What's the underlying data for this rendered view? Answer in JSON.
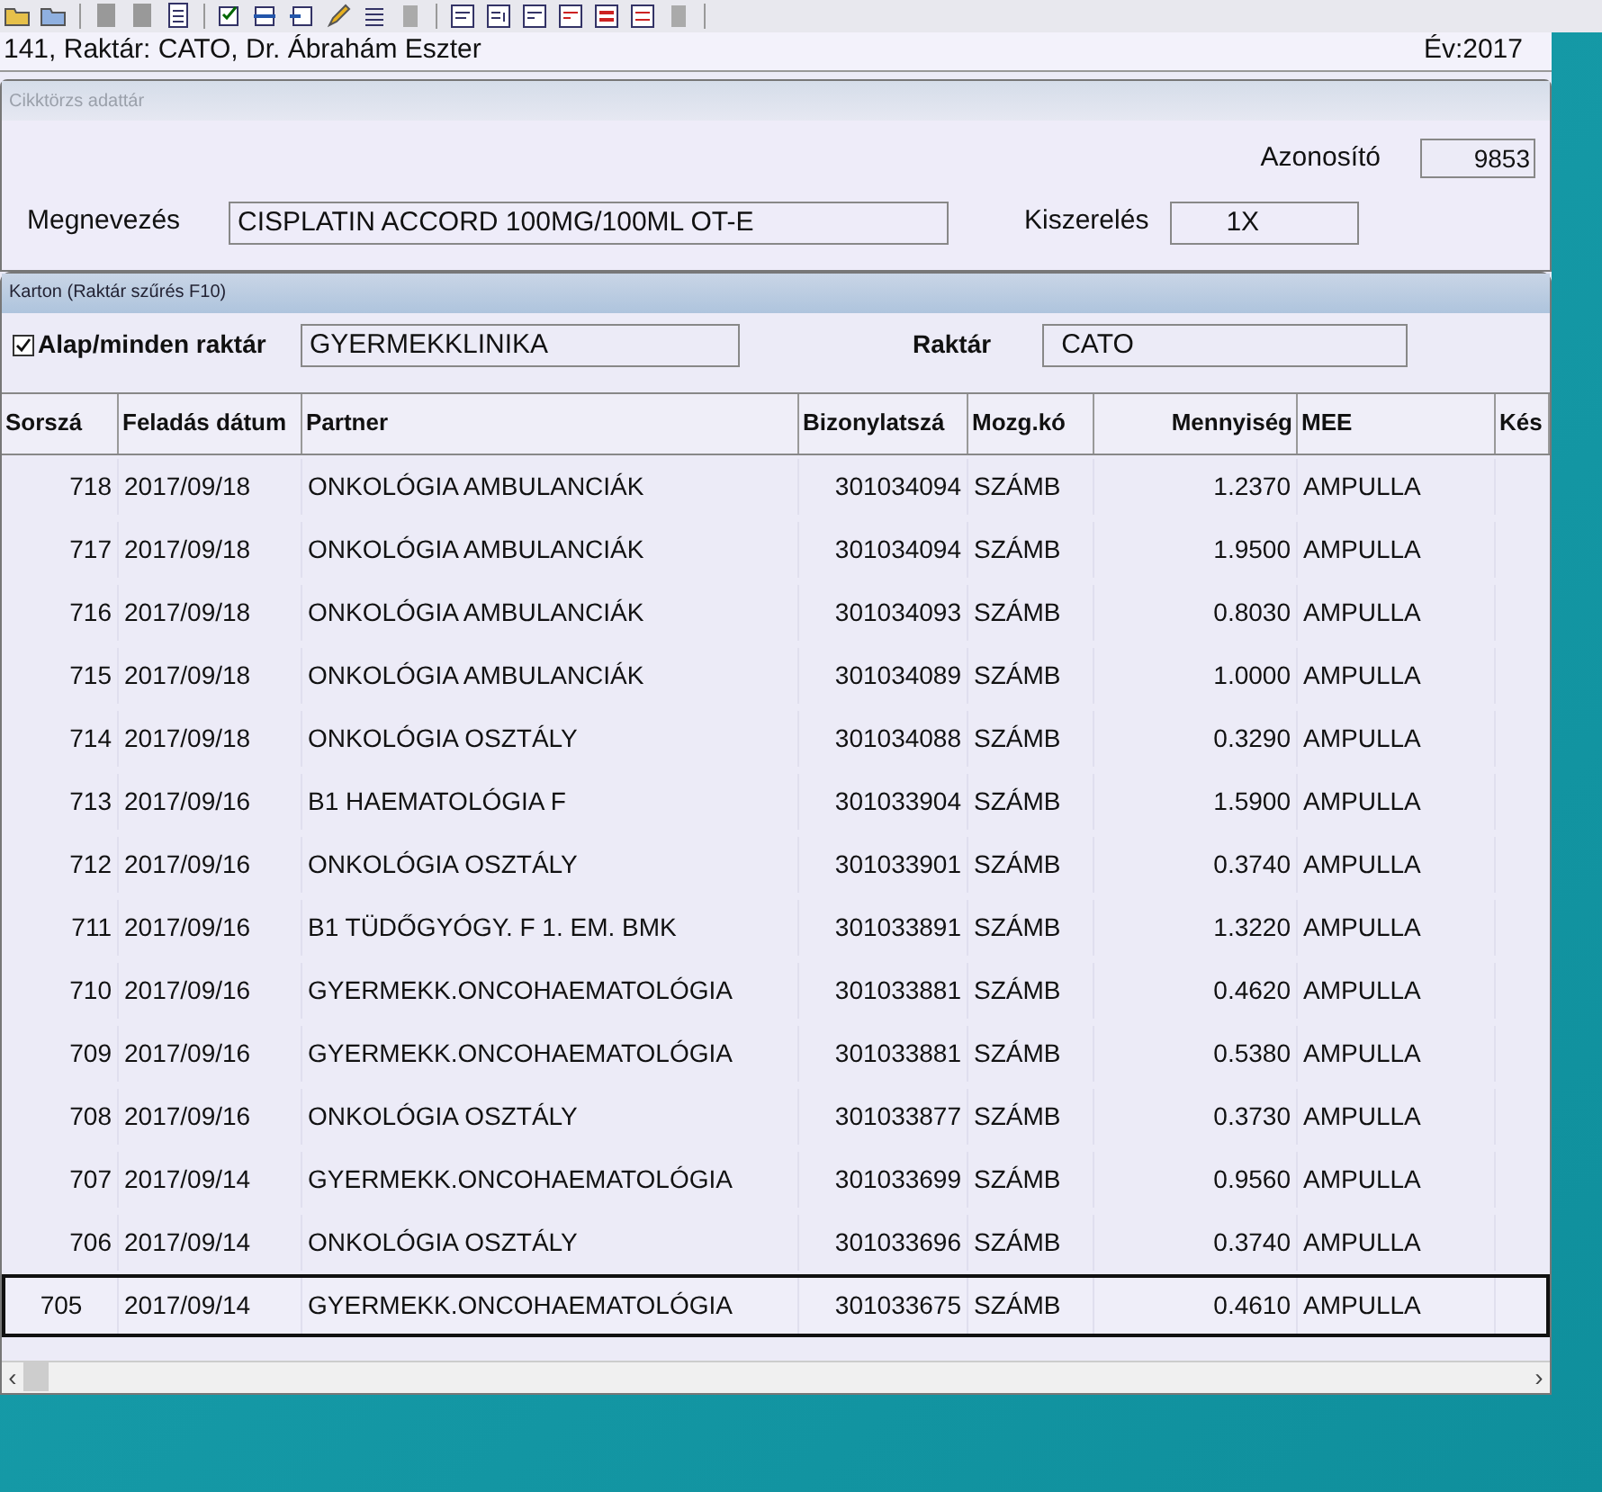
{
  "title_bar": {
    "title": "141, Raktár: CATO, Dr. Ábrahám Eszter",
    "year": "Év:2017"
  },
  "article_panel": {
    "caption": "Cikktörzs adattár",
    "id_label": "Azonosító",
    "id_value": "9853",
    "name_label": "Megnevezés",
    "name_value": "CISPLATIN ACCORD 100MG/100ML  OT-E",
    "pack_label": "Kiszerelés",
    "pack_value": "1X"
  },
  "card_panel": {
    "caption": "Karton (Raktár szűrés F10)",
    "all_stores": {
      "label": "Alap/minden raktár",
      "checked": true
    },
    "store_group": "GYERMEKKLINIKA",
    "store_label": "Raktár",
    "store_value": "CATO"
  },
  "table": {
    "columns": [
      "Sorszá",
      "Feladás dátum",
      "Partner",
      "Bizonylatszá",
      "Mozg.kó",
      "Mennyiség",
      "MEE",
      "Kés"
    ],
    "rows": [
      {
        "cells": [
          "718",
          "2017/09/18",
          "ONKOLÓGIA AMBULANCIÁK",
          "301034094",
          "SZÁMB",
          "1.2370",
          "AMPULLA"
        ],
        "selected": false
      },
      {
        "cells": [
          "717",
          "2017/09/18",
          "ONKOLÓGIA AMBULANCIÁK",
          "301034094",
          "SZÁMB",
          "1.9500",
          "AMPULLA"
        ],
        "selected": false
      },
      {
        "cells": [
          "716",
          "2017/09/18",
          "ONKOLÓGIA AMBULANCIÁK",
          "301034093",
          "SZÁMB",
          "0.8030",
          "AMPULLA"
        ],
        "selected": false
      },
      {
        "cells": [
          "715",
          "2017/09/18",
          "ONKOLÓGIA AMBULANCIÁK",
          "301034089",
          "SZÁMB",
          "1.0000",
          "AMPULLA"
        ],
        "selected": false
      },
      {
        "cells": [
          "714",
          "2017/09/18",
          "ONKOLÓGIA OSZTÁLY",
          "301034088",
          "SZÁMB",
          "0.3290",
          "AMPULLA"
        ],
        "selected": false
      },
      {
        "cells": [
          "713",
          "2017/09/16",
          "B1 HAEMATOLÓGIA F",
          "301033904",
          "SZÁMB",
          "1.5900",
          "AMPULLA"
        ],
        "selected": false
      },
      {
        "cells": [
          "712",
          "2017/09/16",
          "ONKOLÓGIA OSZTÁLY",
          "301033901",
          "SZÁMB",
          "0.3740",
          "AMPULLA"
        ],
        "selected": false
      },
      {
        "cells": [
          "711",
          "2017/09/16",
          "B1 TÜDŐGYÓGY. F  1. EM. BMK",
          "301033891",
          "SZÁMB",
          "1.3220",
          "AMPULLA"
        ],
        "selected": false
      },
      {
        "cells": [
          "710",
          "2017/09/16",
          "GYERMEKK.ONCOHAEMATOLÓGIA",
          "301033881",
          "SZÁMB",
          "0.4620",
          "AMPULLA"
        ],
        "selected": false
      },
      {
        "cells": [
          "709",
          "2017/09/16",
          "GYERMEKK.ONCOHAEMATOLÓGIA",
          "301033881",
          "SZÁMB",
          "0.5380",
          "AMPULLA"
        ],
        "selected": false
      },
      {
        "cells": [
          "708",
          "2017/09/16",
          "ONKOLÓGIA OSZTÁLY",
          "301033877",
          "SZÁMB",
          "0.3730",
          "AMPULLA"
        ],
        "selected": false
      },
      {
        "cells": [
          "707",
          "2017/09/14",
          "GYERMEKK.ONCOHAEMATOLÓGIA",
          "301033699",
          "SZÁMB",
          "0.9560",
          "AMPULLA"
        ],
        "selected": false
      },
      {
        "cells": [
          "706",
          "2017/09/14",
          "ONKOLÓGIA OSZTÁLY",
          "301033696",
          "SZÁMB",
          "0.3740",
          "AMPULLA"
        ],
        "selected": false
      },
      {
        "cells": [
          "705",
          "2017/09/14",
          "GYERMEKK.ONCOHAEMATOLÓGIA",
          "301033675",
          "SZÁMB",
          "0.4610",
          "AMPULLA"
        ],
        "selected": true
      }
    ]
  },
  "scrollbar": {
    "left": "‹",
    "right": "›"
  }
}
